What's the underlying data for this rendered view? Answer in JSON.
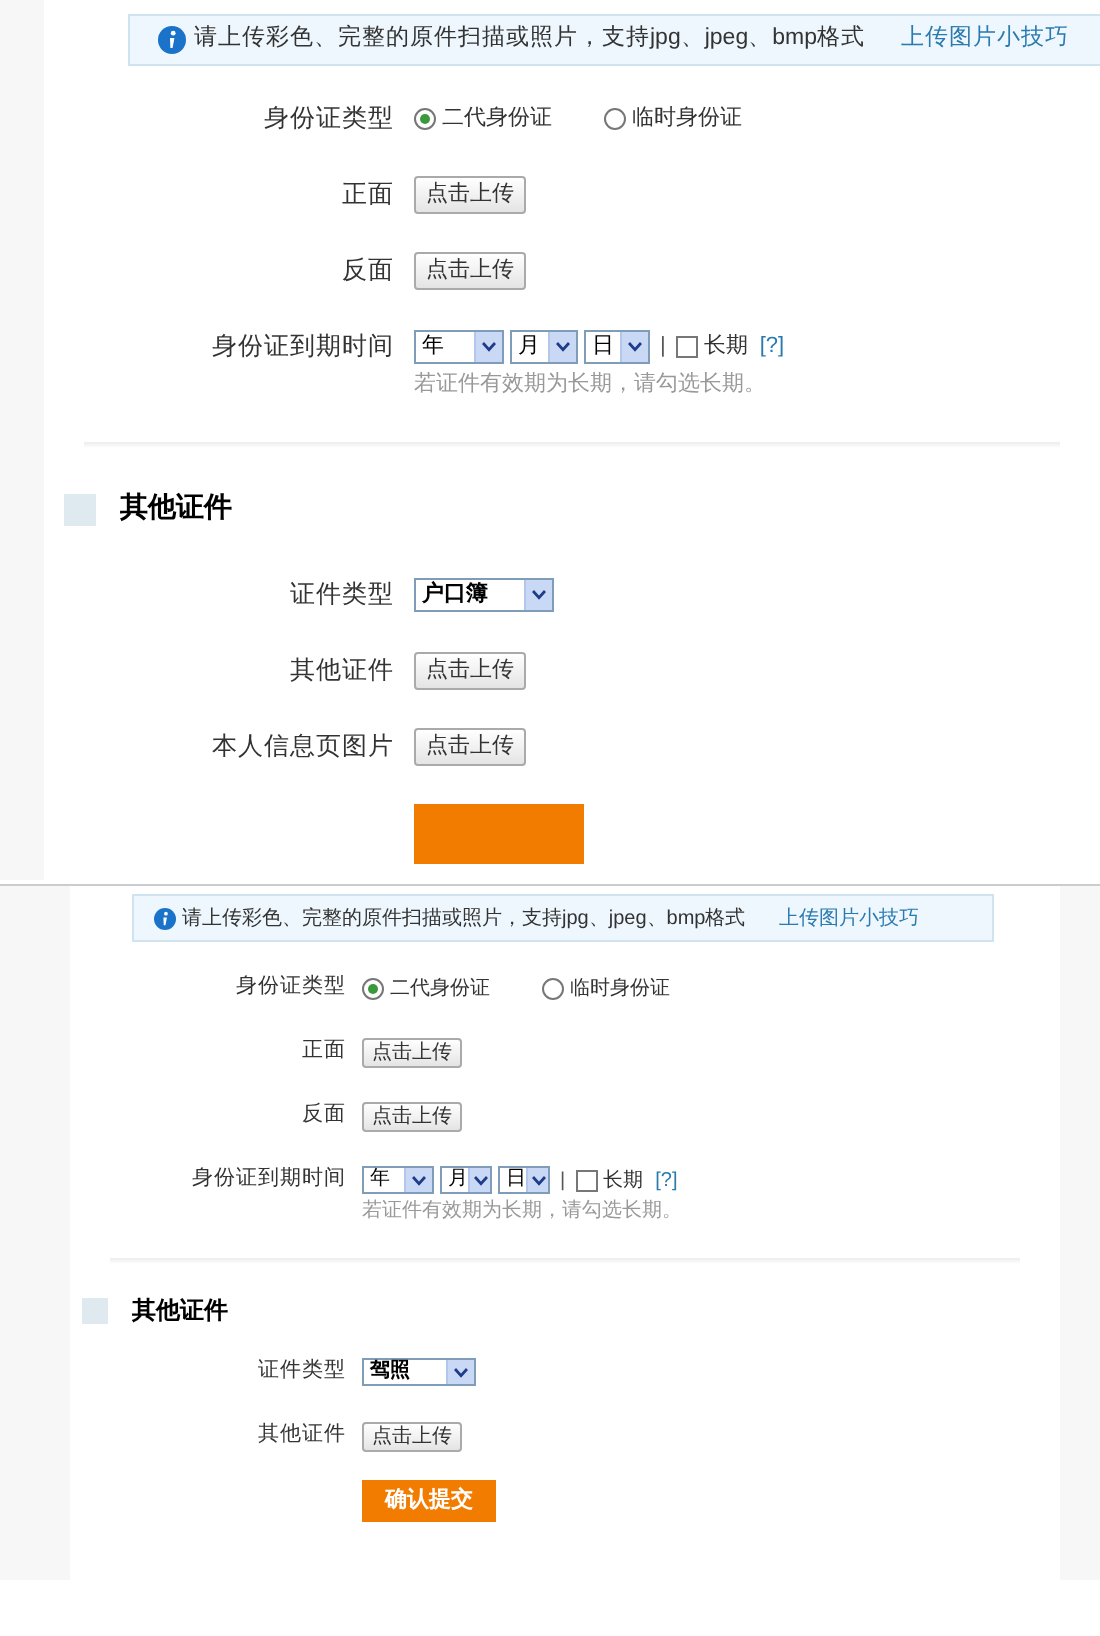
{
  "screens": [
    {
      "info": {
        "text": "请上传彩色、完整的原件扫描或照片，支持jpg、jpeg、bmp格式",
        "link": "上传图片小技巧"
      },
      "id_type": {
        "label": "身份证类型",
        "options": [
          {
            "label": "二代身份证",
            "selected": true
          },
          {
            "label": "临时身份证",
            "selected": false
          }
        ]
      },
      "uploads": [
        {
          "label": "正面",
          "button": "点击上传"
        },
        {
          "label": "反面",
          "button": "点击上传"
        }
      ],
      "expiry": {
        "label": "身份证到期时间",
        "selects": [
          {
            "value": "年"
          },
          {
            "value": "月"
          },
          {
            "value": "日"
          }
        ],
        "separator": "|",
        "long_term": {
          "label": "长期",
          "checked": false
        },
        "help": "[?]",
        "hint": "若证件有效期为长期，请勾选长期。"
      },
      "other": {
        "title": "其他证件",
        "type": {
          "label": "证件类型",
          "value": "户口簿"
        },
        "uploads": [
          {
            "label": "其他证件",
            "button": "点击上传"
          },
          {
            "label": "本人信息页图片",
            "button": "点击上传"
          }
        ]
      },
      "submit": {
        "kind": "cut"
      }
    },
    {
      "info": {
        "text": "请上传彩色、完整的原件扫描或照片，支持jpg、jpeg、bmp格式",
        "link": "上传图片小技巧"
      },
      "id_type": {
        "label": "身份证类型",
        "options": [
          {
            "label": "二代身份证",
            "selected": true
          },
          {
            "label": "临时身份证",
            "selected": false
          }
        ]
      },
      "uploads": [
        {
          "label": "正面",
          "button": "点击上传"
        },
        {
          "label": "反面",
          "button": "点击上传"
        }
      ],
      "expiry": {
        "label": "身份证到期时间",
        "selects": [
          {
            "value": "年"
          },
          {
            "value": "月"
          },
          {
            "value": "日"
          }
        ],
        "separator": "|",
        "long_term": {
          "label": "长期",
          "checked": false
        },
        "help": "[?]",
        "hint": "若证件有效期为长期，请勾选长期。"
      },
      "other": {
        "title": "其他证件",
        "type": {
          "label": "证件类型",
          "value": "驾照"
        },
        "uploads": [
          {
            "label": "其他证件",
            "button": "点击上传"
          }
        ]
      },
      "submit": {
        "kind": "full",
        "label": "确认提交"
      }
    }
  ]
}
